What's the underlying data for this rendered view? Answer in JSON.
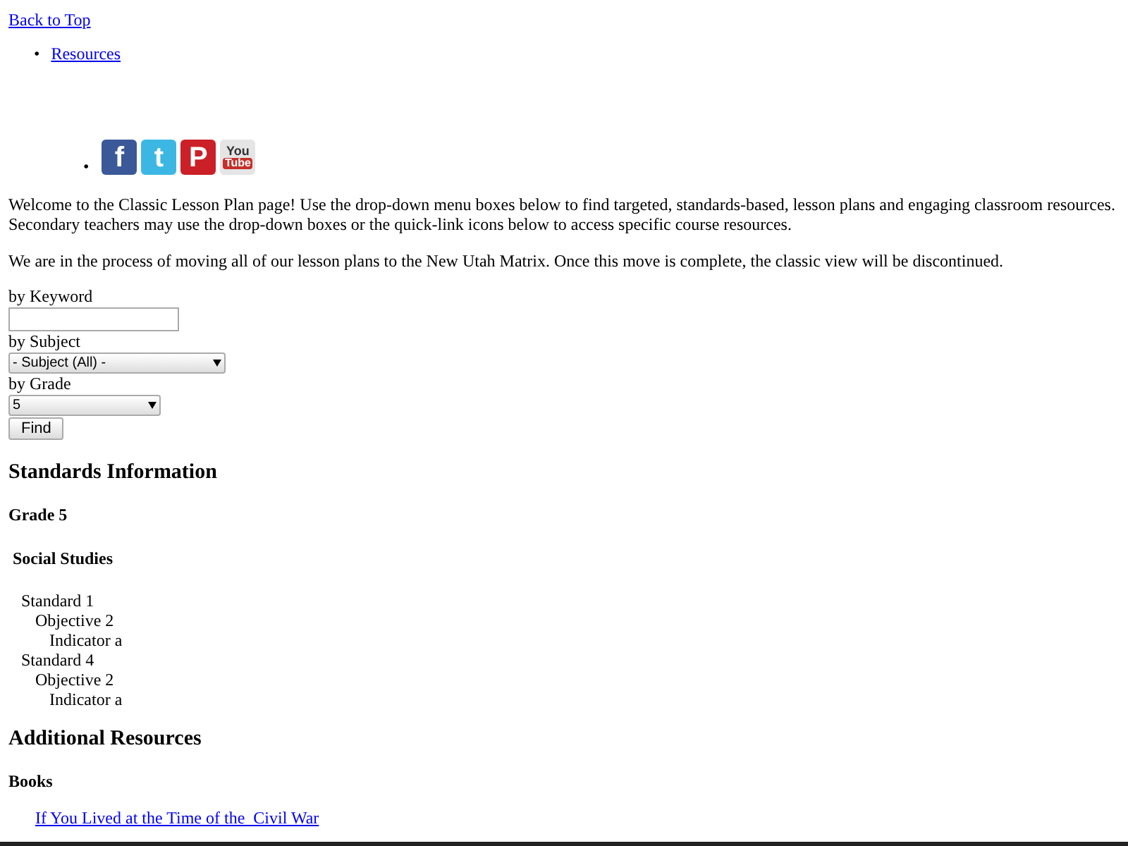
{
  "top_link": "Back to Top",
  "nav": [
    {
      "marker": "•",
      "label": "Resources"
    }
  ],
  "social_marker": "•",
  "social_icons": [
    {
      "kind": "facebook",
      "glyph": "f"
    },
    {
      "kind": "twitter",
      "glyph": "t"
    },
    {
      "kind": "pinterest",
      "glyph": "P"
    },
    {
      "kind": "youtube",
      "glyph": "You",
      "glyph_2": "Tube"
    }
  ],
  "paragraphs": [
    "Welcome to the Classic Lesson Plan page! Use the drop-down menu boxes below to find targeted, standards-based, lesson plans and engaging classroom resources. Secondary teachers may use the drop-down boxes or the quick-link icons below to access specific course resources.",
    "We are in the process of moving all of our lesson plans to the New Utah Matrix. Once this move is complete, the classic view will be discontinued."
  ],
  "search": {
    "keyword_label": "by Keyword",
    "subject_label": "by Subject",
    "subject_value": "- Subject (All) -",
    "grade_label": "by Grade",
    "grade_value": "5",
    "button": "Find"
  },
  "standards": {
    "heading": "Standards Information",
    "grade": "Grade 5",
    "subject": "Social Studies",
    "tree": [
      {
        "label": "Standard 1",
        "children": [
          {
            "label": "Objective 2",
            "children": [
              {
                "label": "Indicator a"
              }
            ]
          }
        ]
      },
      {
        "label": "Standard 4",
        "children": [
          {
            "label": "Objective 2",
            "children": [
              {
                "label": "Indicator a"
              }
            ]
          }
        ]
      }
    ]
  },
  "additional": {
    "heading": "Additional Resources",
    "subheading": "Books",
    "links": [
      "If You Lived at the Time of the  Civil War"
    ]
  }
}
